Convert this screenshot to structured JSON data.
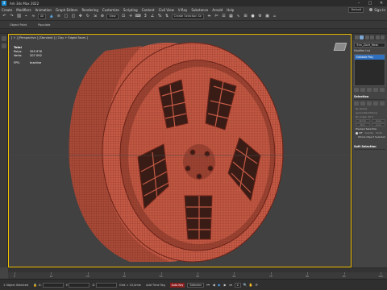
{
  "window": {
    "title": "Ark 3ds Max 2022",
    "min": "–",
    "max": "□",
    "close": "✕"
  },
  "menu": {
    "items": [
      "Create",
      "Modifiers",
      "Animation",
      "Graph Editors",
      "Rendering",
      "Customize",
      "Scripting",
      "Content",
      "Civil View",
      "V-Ray",
      "Substance",
      "Arnold",
      "Help"
    ],
    "workspace": "Default",
    "signin": "Sign In"
  },
  "toolbar": {
    "selection_filter": "All",
    "create_selection_set": "Create Selection Se",
    "view_dropdown": "View"
  },
  "ribbon": {
    "tabs": [
      "Object Paint",
      "Populate"
    ]
  },
  "viewport": {
    "label": "[ + ] [Perspective ] [Standard ] [ Clay + Edged Faces ]",
    "stats": {
      "total_label": "Total",
      "polys_label": "Polys:",
      "polys_value": "393 976",
      "verts_label": "Verts:",
      "verts_value": "207 092",
      "fps_label": "FPS:",
      "fps_value": "Inactive"
    },
    "mesh_color": "#c55a45",
    "wire_color": "#6a2318"
  },
  "command_panel": {
    "object_name": "Trim_Z0x9_Mesh",
    "modifier_list": "Modifier List",
    "stack_item": "Editable Poly",
    "selection_title": "Selection",
    "by_vertex": "By Vertex",
    "ignore_backfacing": "Ignore Backfacing",
    "by_angle": "By Angle: 45.0",
    "shrink": "Shrink",
    "grow": "Grow",
    "ring": "Ring",
    "loop": "Loop",
    "preview_selection": "Preview Selection",
    "off": "Off",
    "subobj": "SubObj",
    "multi": "Multi",
    "whole_object": "Whole Object Selected",
    "soft_selection": "Soft Selection"
  },
  "timeline": {
    "ticks": [
      "0",
      "10",
      "20",
      "30",
      "40",
      "50",
      "60",
      "70",
      "80",
      "90",
      "100"
    ]
  },
  "status": {
    "selected": "1 Object Selected",
    "x_label": "X:",
    "y_label": "Y:",
    "z_label": "Z:",
    "grid": "Grid = 10,0mm",
    "auto_key": "Auto Key",
    "selected_dd": "Selected",
    "add_time_tag": "Add Time Tag",
    "frame": "0"
  }
}
